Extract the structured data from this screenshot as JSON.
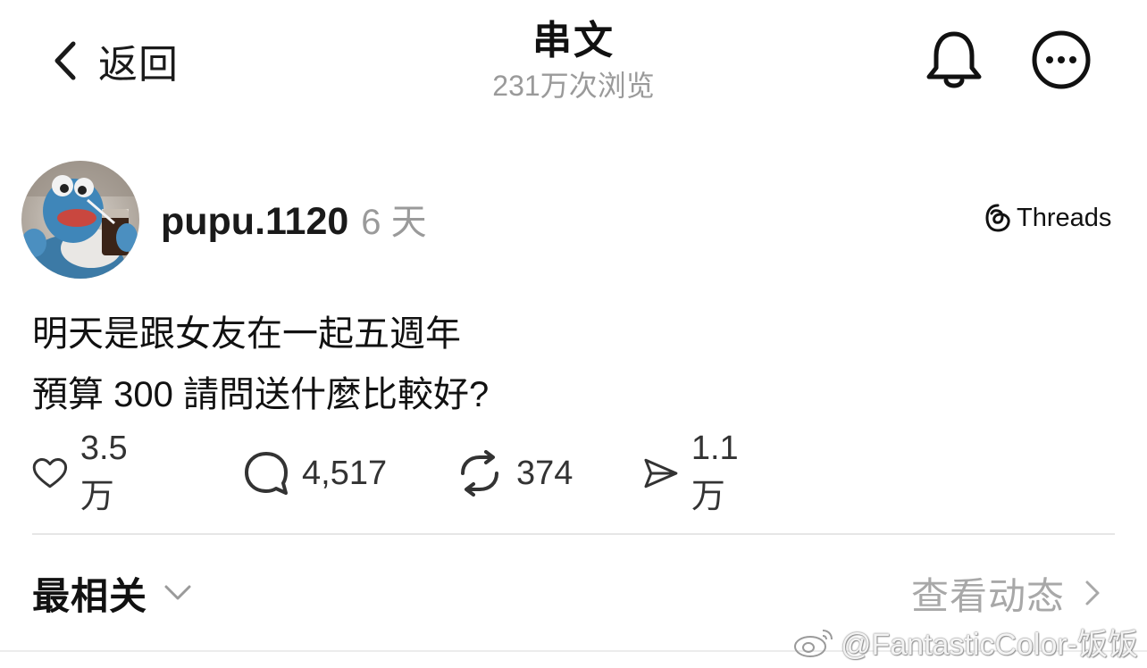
{
  "header": {
    "back_label": "返回",
    "title": "串文",
    "subtitle": "231万次浏览"
  },
  "post": {
    "username": "pupu.1120",
    "age": "6 天",
    "source_badge": "Threads",
    "body_lines": [
      "明天是跟女友在一起五週年",
      "預算 300 請問送什麼比較好?"
    ],
    "actions": {
      "likes": "3.5万",
      "comments": "4,517",
      "reposts": "374",
      "shares": "1.1万"
    }
  },
  "sort": {
    "label": "最相关",
    "activity_label": "查看动态"
  },
  "watermark": {
    "text": "@FantasticColor-饭饭"
  },
  "icons": {
    "back": "chevron-left-icon",
    "bell": "bell-icon",
    "more": "more-horizontal-icon",
    "threads": "threads-logo-icon",
    "like": "heart-icon",
    "comment": "comment-bubble-icon",
    "repost": "repost-icon",
    "share": "send-icon",
    "sort_chevron": "chevron-down-icon",
    "activity_chevron": "chevron-right-icon",
    "weibo": "weibo-logo-icon"
  }
}
